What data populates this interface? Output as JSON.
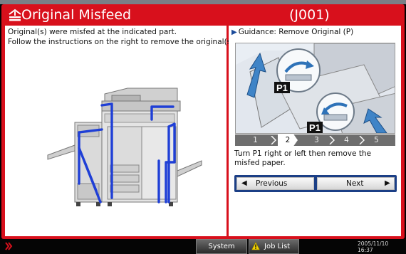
{
  "title": {
    "text": "Original Misfeed",
    "code": "(J001)",
    "icon": "misfeed-icon"
  },
  "message": {
    "line1": "Original(s) were misfed at the indicated part.",
    "line2": "Follow the instructions on the right to remove the original(s)."
  },
  "guidance": {
    "label": "Guidance: Remove Original (P)",
    "image_labels": {
      "p1_top": "P1",
      "p1_bottom": "P1"
    },
    "steps": [
      "1",
      "2",
      "3",
      "4",
      "5"
    ],
    "active_step": "2",
    "instruction": "Turn P1 right or left then remove the misfed paper.",
    "prev_label": "Previous",
    "next_label": "Next"
  },
  "bottom": {
    "system_status": "System Status",
    "job_list": "Job List",
    "date": "2005/11/10",
    "time": "16:37"
  },
  "colors": {
    "frame": "#d8101c",
    "nav": "#1b3f86",
    "indicator": "#1f3fd6"
  }
}
